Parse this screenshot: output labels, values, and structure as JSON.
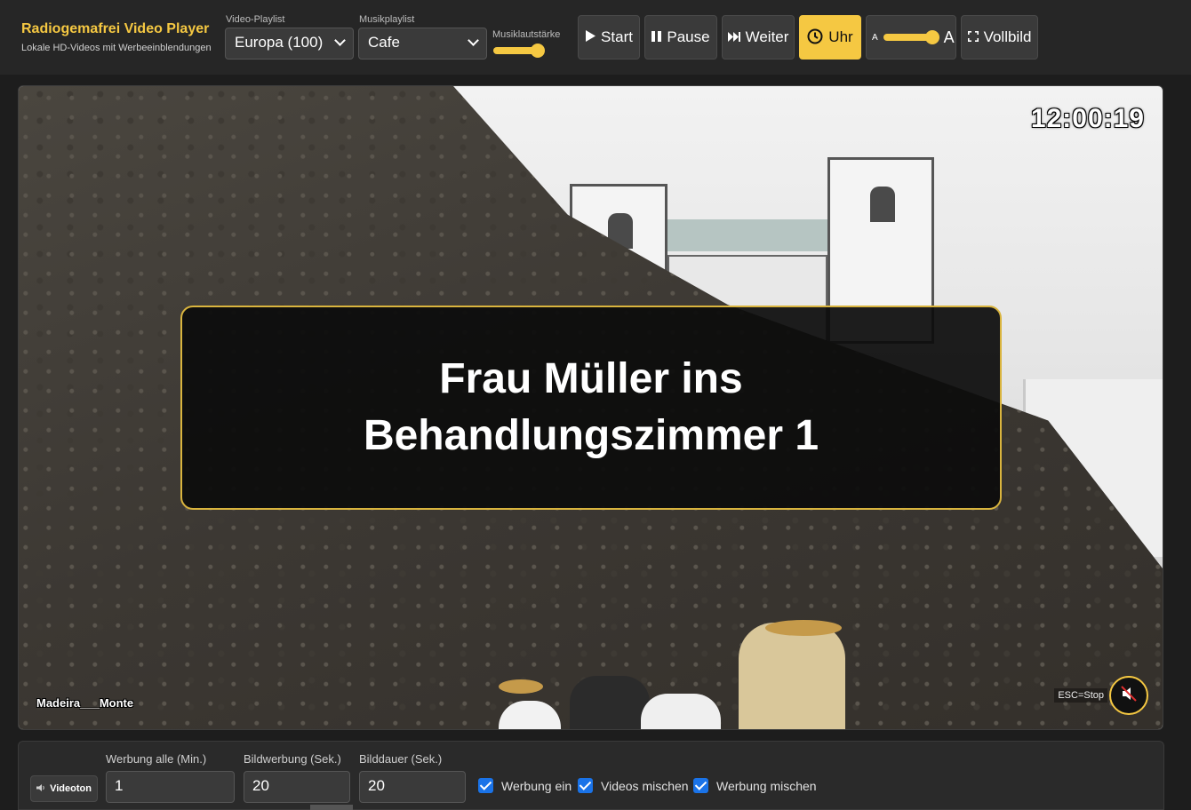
{
  "app": {
    "title": "Radiogemafrei Video Player",
    "subtitle": "Lokale HD-Videos mit Werbeeinblendungen"
  },
  "header": {
    "video_playlist_label": "Video-Playlist",
    "video_playlist_value": "Europa (100)",
    "music_playlist_label": "Musikplaylist",
    "music_playlist_value": "Cafe",
    "music_volume_label": "Musiklautstärke",
    "music_volume_level": 0.9,
    "buttons": {
      "start": "Start",
      "pause": "Pause",
      "next": "Weiter",
      "clock": "Uhr",
      "font_small": "A",
      "font_large": "A",
      "fullscreen": "Vollbild"
    },
    "font_size_level": 0.95,
    "accent_color": "#f5c842"
  },
  "video": {
    "clock_time": "12:00:19",
    "caption": "Madeira___Monte",
    "esc_hint": "ESC=Stop",
    "overlay_message": "Frau Müller ins Behandlungszimmer 1",
    "mute_icon": "speaker-muted-icon"
  },
  "controls": {
    "videoton_label": "Videoton",
    "ad_interval_label": "Werbung alle (Min.)",
    "ad_interval_value": "1",
    "image_ad_label": "Bildwerbung (Sek.)",
    "image_ad_value": "20",
    "image_duration_label": "Bilddauer (Sek.)",
    "image_duration_value": "20",
    "checkboxes": [
      {
        "label": "Werbung ein",
        "checked": true
      },
      {
        "label": "Videos mischen",
        "checked": true
      },
      {
        "label": "Werbung mischen",
        "checked": true
      }
    ]
  }
}
